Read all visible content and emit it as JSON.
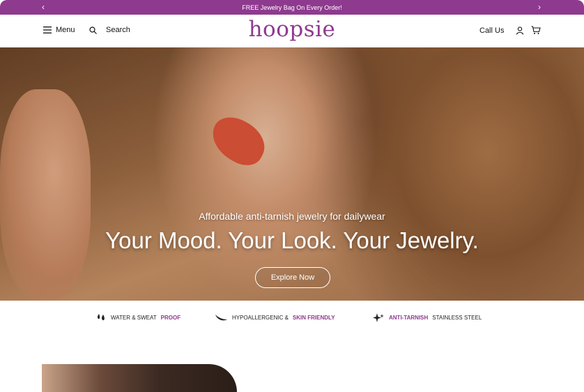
{
  "announcement": {
    "prev": "‹",
    "text": "FREE Jewelry Bag On Every Order!",
    "next": "›"
  },
  "header": {
    "menu_label": "Menu",
    "search_label": "Search",
    "logo": "hoopsie",
    "call_label": "Call Us"
  },
  "hero": {
    "subtitle": "Affordable anti-tarnish jewelry for dailywear",
    "title": "Your Mood. Your Look. Your Jewelry.",
    "cta": "Explore Now"
  },
  "features": [
    {
      "icon": "droplets-icon",
      "text": "WATER & SWEAT",
      "highlight": "PROOF",
      "highlight_first": false
    },
    {
      "icon": "leaf-icon",
      "text": "HYPOALLERGENIC &",
      "highlight": "SKIN FRIENDLY",
      "highlight_first": false
    },
    {
      "icon": "sparkle-icon",
      "text": "STAINLESS STEEL",
      "highlight": "ANTI-TARNISH",
      "highlight_first": true
    }
  ],
  "colors": {
    "brand": "#8e3a8f",
    "announcement_bg": "#8e3a8f"
  }
}
